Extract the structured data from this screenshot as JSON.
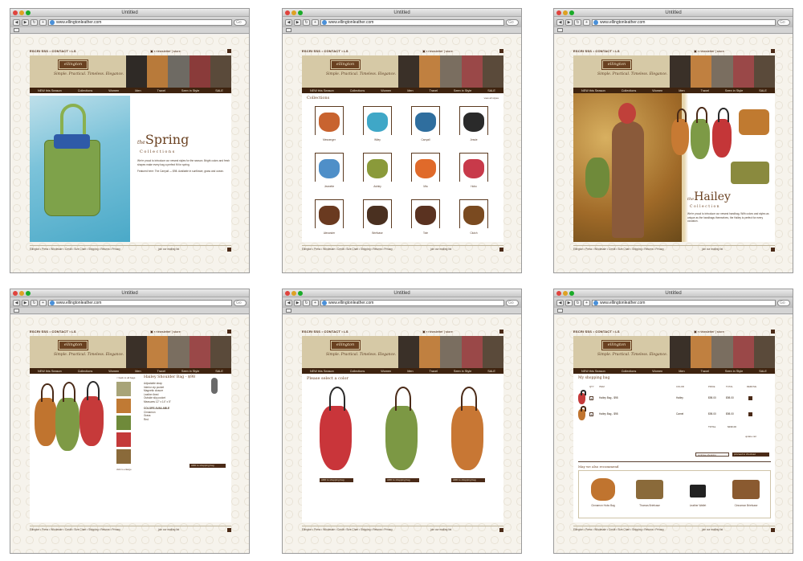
{
  "window": {
    "title": "Untitled",
    "url": "www.ellingtonleather.com",
    "search_placeholder": "Go"
  },
  "site": {
    "topbar_left": "ESCRI  SSS  •  CONTACT  •  LS",
    "topbar_right": "▣ ▪ newsletter  |  store",
    "logo": "ellington",
    "tagline": "Simple. Practical. Timeless. Elegance.",
    "nav": [
      "NEW this Season",
      "Collections",
      "Women",
      "Men",
      "Travel",
      "Seen in Style",
      "SALE"
    ],
    "footer_text": "Ellington • Press • Wholesale • Credit • Size Chart • Shipping • Returns • Privacy",
    "footer_join": "join our mailing list"
  },
  "panel1": {
    "the": "the",
    "title": "Spring",
    "subtitle": "Collections",
    "body1": "We're proud to introduce our newest styles for the season. Bright colors and fresh shapes make every bag a perfect fit for spring.",
    "body2": "Featured here: The Carryall — $98. Available in sunflower, grass and ocean."
  },
  "panel2": {
    "heading": "Collections",
    "view_all": "view all styles",
    "items": [
      "Messenger",
      "Wiley",
      "Carryall",
      "Jessie",
      "Jeanette",
      "Ashley",
      "Mia",
      "Hobo",
      "Alexander",
      "Briefcase",
      "Tote",
      "Clutch"
    ]
  },
  "panel3": {
    "the": "the",
    "title": "Hailey",
    "subtitle": "Collection",
    "body": "We're proud to introduce our newest handbag. With colors and styles as unique as the handbags themselves, the Hailey is perfect for every occasion."
  },
  "panel4": {
    "product_title": "Hailey Shoulder Bag - $98",
    "breadcrumb": "< back to all bags",
    "features": [
      "Adjustable strap",
      "Interior zip pocket",
      "Magnetic closure",
      "Leather lined",
      "Outside slip pocket",
      "Measures 12\" x 14\" x 5\""
    ],
    "colors_heading": "COLORS AVAILABLE",
    "colors": [
      "Cinnamon",
      "Grass",
      "Red"
    ],
    "add_button": "ADD to shopping bag",
    "enlarge": "click to enlarge"
  },
  "panel5": {
    "heading": "Please select a color",
    "add_buttons": [
      "ADD to shopping bag",
      "ADD to shopping bag",
      "ADD to shopping bag"
    ]
  },
  "panel6": {
    "heading": "My shopping bag",
    "columns": [
      "QTY",
      "ITEM",
      "COLOR",
      "PRICE",
      "TOTAL",
      "REMOVE"
    ],
    "rows": [
      {
        "qty": "1",
        "item": "Hailey Bag - $98",
        "color": "Hailey",
        "price": "$98.00",
        "total": "$98.00"
      },
      {
        "qty": "1",
        "item": "Hailey Bag - $98",
        "color": "Camel",
        "price": "$98.00",
        "total": "$98.00"
      }
    ],
    "subtotal_label": "TOTAL",
    "subtotal": "$196.00",
    "update": "update cart",
    "continue": "continue shopping",
    "checkout": "proceed to checkout",
    "recommend_heading": "May we also recommend",
    "recommendations": [
      "Cinnamon Hobo Bag",
      "Thomas Briefcase",
      "Leather Wallet",
      "Cinnamon Briefcase"
    ]
  },
  "colors": {
    "brown": "#4a2a17",
    "tan": "#d6c9a6",
    "accent": "#6a4121"
  }
}
